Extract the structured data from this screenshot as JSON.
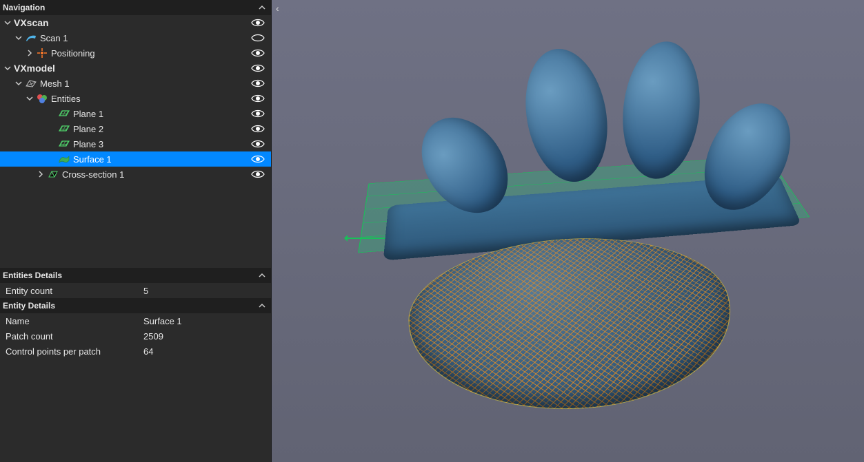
{
  "sidebar": {
    "nav_header": "Navigation",
    "tree": {
      "vxscan": "VXscan",
      "scan1": "Scan 1",
      "positioning": "Positioning",
      "vxmodel": "VXmodel",
      "mesh1": "Mesh 1",
      "entities": "Entities",
      "plane1": "Plane 1",
      "plane2": "Plane 2",
      "plane3": "Plane 3",
      "surface1": "Surface 1",
      "crosssection1": "Cross-section 1"
    },
    "entities_details_header": "Entities Details",
    "entities_details": {
      "entity_count_label": "Entity count",
      "entity_count_value": "5"
    },
    "entity_details_header": "Entity Details",
    "entity_details": {
      "name_label": "Name",
      "name_value": "Surface 1",
      "patch_count_label": "Patch count",
      "patch_count_value": "2509",
      "cpp_label": "Control points per patch",
      "cpp_value": "64"
    }
  },
  "viewport": {
    "back_glyph": "‹"
  }
}
